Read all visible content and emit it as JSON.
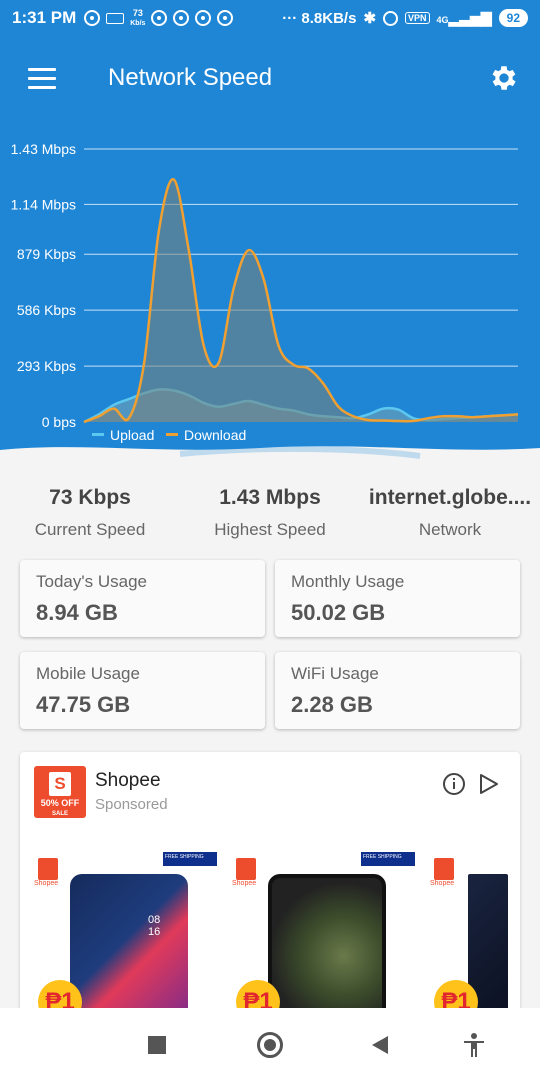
{
  "status_bar": {
    "time": "1:31 PM",
    "speed_small": "73",
    "speed_small_unit": "Kb/s",
    "net_speed": "··· 8.8KB/s",
    "vpn": "VPN",
    "signal": "4G",
    "battery": "92"
  },
  "app_bar": {
    "title": "Network Speed",
    "menu_icon": "hamburger-menu-icon",
    "settings_icon": "gear-icon"
  },
  "chart_data": {
    "type": "area",
    "y_tick_labels": [
      "1.43 Mbps",
      "1.14 Mbps",
      "879 Kbps",
      "586 Kbps",
      "293 Kbps",
      "0 bps"
    ],
    "y_ticks_kbps": [
      1430,
      1140,
      879,
      586,
      293,
      0
    ],
    "ylim_kbps": [
      0,
      1430
    ],
    "x_samples": 30,
    "series": [
      {
        "name": "Upload",
        "color": "#5cc8f0",
        "values_kbps": [
          0,
          40,
          90,
          120,
          150,
          170,
          165,
          140,
          100,
          80,
          95,
          110,
          90,
          70,
          60,
          40,
          30,
          25,
          20,
          40,
          70,
          65,
          20,
          10,
          15,
          20,
          25,
          30,
          35,
          40
        ]
      },
      {
        "name": "Download",
        "color": "#f0a030",
        "values_kbps": [
          0,
          30,
          70,
          20,
          300,
          1000,
          1270,
          900,
          400,
          310,
          700,
          900,
          750,
          400,
          300,
          280,
          200,
          80,
          30,
          10,
          8,
          5,
          5,
          20,
          30,
          30,
          25,
          30,
          35,
          40
        ]
      }
    ],
    "grid": true,
    "legend_position": "bottom-left"
  },
  "stats": [
    {
      "value": "73 Kbps",
      "label": "Current Speed"
    },
    {
      "value": "1.43 Mbps",
      "label": "Highest Speed"
    },
    {
      "value": "internet.globe....",
      "label": "Network"
    }
  ],
  "usage": [
    {
      "label": "Today's Usage",
      "value": "8.94 GB"
    },
    {
      "label": "Monthly Usage",
      "value": "50.02 GB"
    },
    {
      "label": "Mobile Usage",
      "value": "47.75 GB"
    },
    {
      "label": "WiFi Usage",
      "value": "2.28 GB"
    }
  ],
  "ad": {
    "title": "Shopee",
    "sponsored": "Sponsored",
    "logo_letter": "S",
    "logo_badge": "50% OFF",
    "logo_badge_sub": "SALE",
    "shop_label": "Shopee",
    "ship_label": "FREE SHIPPING",
    "price_symbol": "₱1",
    "phone_time": "08 16"
  },
  "nav_bar": {
    "recents_icon": "square-recents-icon",
    "home_icon": "circle-home-icon",
    "back_icon": "triangle-back-icon",
    "accessibility_icon": "accessibility-icon"
  }
}
